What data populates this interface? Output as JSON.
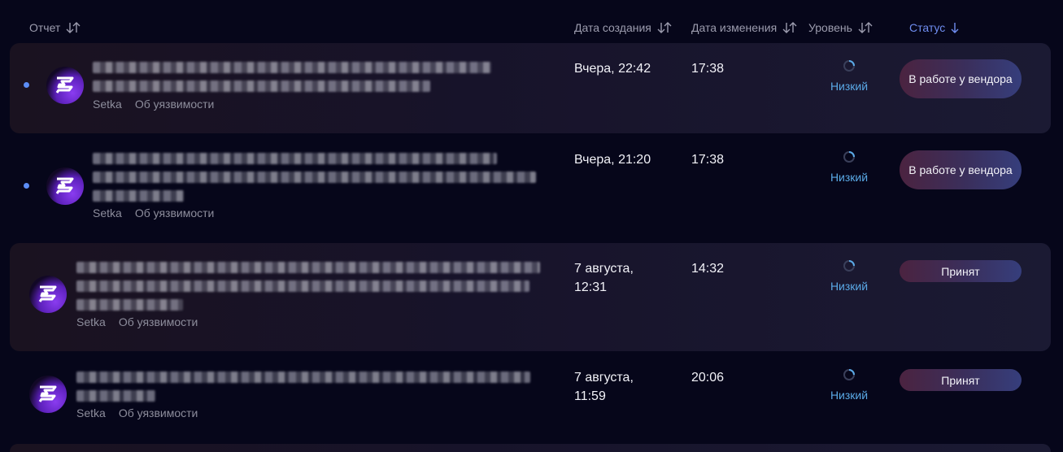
{
  "header": {
    "report": "Отчет",
    "created": "Дата создания",
    "modified": "Дата изменения",
    "level": "Уровень",
    "status": "Статус"
  },
  "colors": {
    "background": "#06061a",
    "accent": "#6f8df0",
    "level_label": "#5aa9e6",
    "unread_dot": "#5c8df6"
  },
  "rows": [
    {
      "unread": true,
      "title_line_count": 2,
      "org": "Setka",
      "category": "Об уязвимости",
      "created": "Вчера, 22:42",
      "modified": "17:38",
      "level": "Низкий",
      "status": "В работе у вендора"
    },
    {
      "unread": true,
      "title_line_count": 3,
      "org": "Setka",
      "category": "Об уязвимости",
      "created": "Вчера, 21:20",
      "modified": "17:38",
      "level": "Низкий",
      "status": "В работе у вендора"
    },
    {
      "unread": false,
      "title_line_count": 3,
      "org": "Setka",
      "category": "Об уязвимости",
      "created": "7 августа, 12:31",
      "modified": "14:32",
      "level": "Низкий",
      "status": "Принят"
    },
    {
      "unread": false,
      "title_line_count": 2,
      "org": "Setka",
      "category": "Об уязвимости",
      "created": "7 августа, 11:59",
      "modified": "20:06",
      "level": "Низкий",
      "status": "Принят"
    }
  ]
}
